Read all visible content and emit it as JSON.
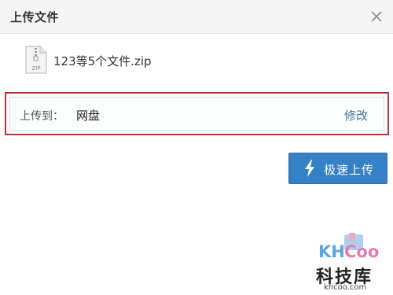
{
  "dialog": {
    "title": "上传文件"
  },
  "file": {
    "name": "123等5个文件.zip",
    "icon_label": "ZIP"
  },
  "destination": {
    "label": "上传到：",
    "value": "网盘",
    "modify_label": "修改"
  },
  "actions": {
    "fast_upload_label": "极速上传"
  },
  "watermark": {
    "logo_text": "KHCoo",
    "site_name": "科技库",
    "domain": "khcoo.com"
  },
  "colors": {
    "accent": "#3481c5",
    "highlight_border": "#b8343a",
    "link": "#3a7a99",
    "titlebar": "#f5f5f5"
  },
  "icons": {
    "close": "close-icon",
    "file": "zip-file-icon",
    "upload": "lightning-icon"
  }
}
